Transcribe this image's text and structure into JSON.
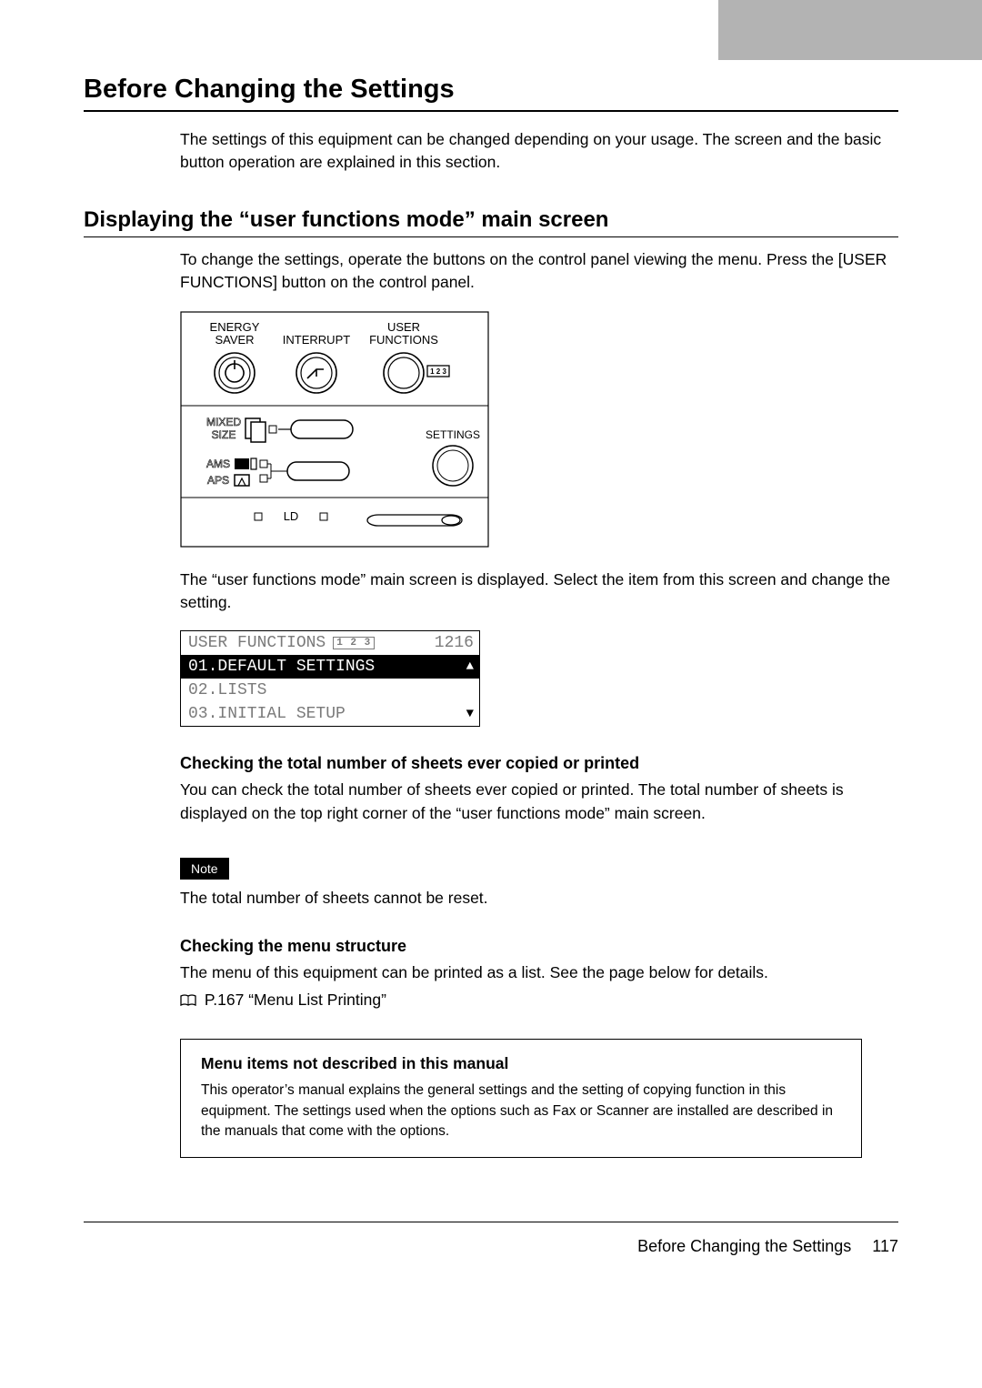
{
  "header": {
    "title": "Before Changing the Settings"
  },
  "intro": {
    "para1": "The settings of this equipment can be changed depending on your usage. The screen and the basic button operation are explained in this section."
  },
  "section1": {
    "title": "Displaying the “user functions mode” main screen",
    "para1": "To change the settings, operate the buttons on the control panel viewing the menu. Press the [USER FUNCTIONS] button on the control panel.",
    "panel_labels": {
      "energy": "ENERGY",
      "saver": "SAVER",
      "interrupt": "INTERRUPT",
      "user": "USER",
      "functions": "FUNCTIONS",
      "mixed": "MIXED",
      "size": "SIZE",
      "ams": "AMS",
      "aps": "APS",
      "settings": "SETTINGS",
      "ld": "LD",
      "btn123": "1 2 3"
    },
    "para2": "The “user functions mode” main screen is displayed. Select the item from this screen and change the setting.",
    "lcd": {
      "title": "USER FUNCTIONS",
      "badge123": "1 2 3",
      "count": "1216",
      "items": [
        {
          "label": "01.DEFAULT SETTINGS",
          "selected": true
        },
        {
          "label": "02.LISTS",
          "selected": false
        },
        {
          "label": "03.INITIAL SETUP",
          "selected": false
        }
      ],
      "up": "▲",
      "down": "▼"
    }
  },
  "section2": {
    "title": "Checking the total number of sheets ever copied or printed",
    "para1": "You can check the total number of sheets ever copied or printed. The total number of sheets is displayed on the top right corner of the “user functions mode” main screen.",
    "note_label": "Note",
    "note_text": "The total number of sheets cannot be reset."
  },
  "section3": {
    "title": "Checking the menu structure",
    "para1": "The menu of this equipment can be printed as a list. See the page below for details.",
    "ref": "P.167 “Menu List Printing”"
  },
  "box": {
    "title": "Menu items not described in this manual",
    "para1": "This operator’s manual explains the general settings and the setting of copying function in this equipment. The settings used when the options such as Fax or Scanner are installed are described in the manuals that come with the options."
  },
  "footer": {
    "label": "Before Changing the Settings",
    "page": "117"
  }
}
